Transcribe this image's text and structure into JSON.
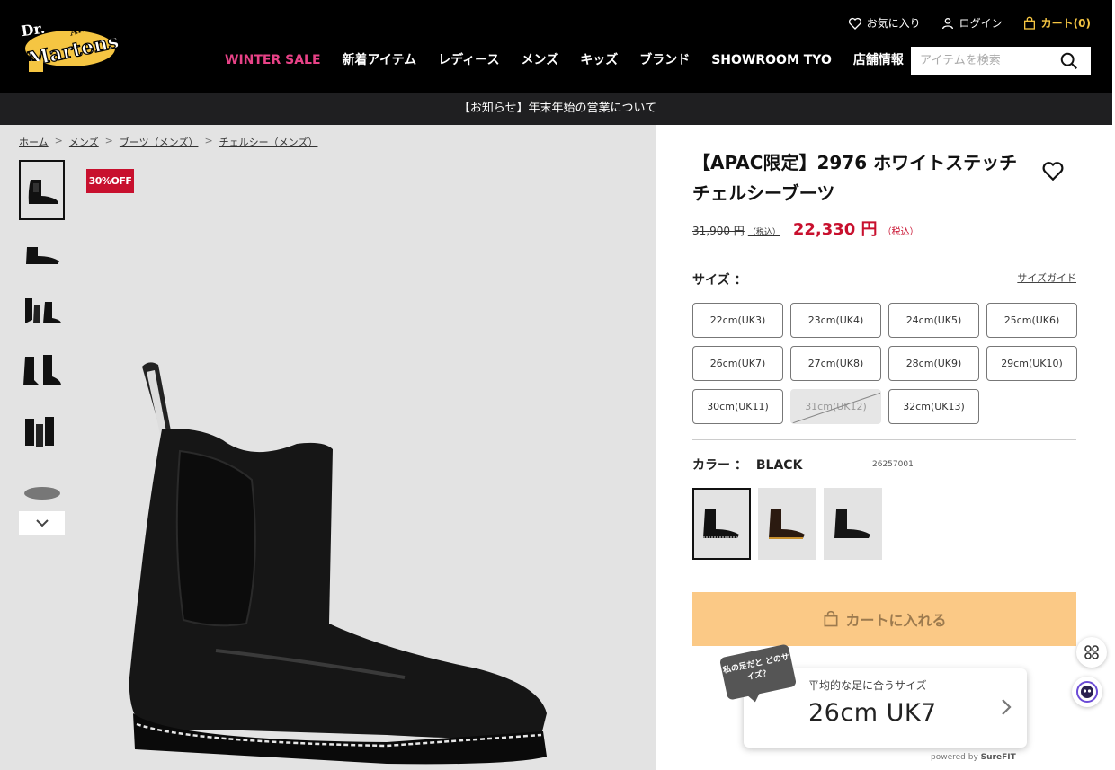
{
  "header": {
    "logo_text": "Dr. Martens AirWair",
    "utility": {
      "favorites": "お気に入り",
      "login": "ログイン",
      "cart": "カート(0)"
    },
    "nav": [
      "WINTER SALE",
      "新着アイテム",
      "レディース",
      "メンズ",
      "キッズ",
      "ブランド",
      "SHOWROOM TYO",
      "店舗情報"
    ],
    "search_placeholder": "アイテムを検索"
  },
  "notice": "【お知らせ】年末年始の営業について",
  "breadcrumb": [
    "ホーム",
    "メンズ",
    "ブーツ（メンズ）",
    "チェルシー（メンズ）"
  ],
  "badge": "30%OFF",
  "product": {
    "title": "【APAC限定】2976 ホワイトステッチ チェルシーブーツ",
    "old_price": "31,900 円",
    "old_price_tax": "（税込）",
    "new_price": "22,330 円",
    "new_price_tax": "（税込）",
    "size_label": "サイズ ：",
    "size_guide": "サイズガイド",
    "sizes": [
      {
        "label": "22cm(UK3)",
        "available": true
      },
      {
        "label": "23cm(UK4)",
        "available": true
      },
      {
        "label": "24cm(UK5)",
        "available": true
      },
      {
        "label": "25cm(UK6)",
        "available": true
      },
      {
        "label": "26cm(UK7)",
        "available": true
      },
      {
        "label": "27cm(UK8)",
        "available": true
      },
      {
        "label": "28cm(UK9)",
        "available": true
      },
      {
        "label": "29cm(UK10)",
        "available": true
      },
      {
        "label": "30cm(UK11)",
        "available": true
      },
      {
        "label": "31cm(UK12)",
        "available": false
      },
      {
        "label": "32cm(UK13)",
        "available": true
      }
    ],
    "color_label": "カラー ：",
    "color_value": "BLACK",
    "sku": "26257001",
    "cart_button": "カートに入れる"
  },
  "surefit": {
    "bubble": "私の足だと どのサイズ？",
    "caption": "平均的な足に合うサイズ",
    "value": "26cm UK7",
    "powered": "powered by",
    "brand": "SureFIT"
  },
  "colors": {
    "sale": "#e84287",
    "badge": "#c8102e",
    "price": "#c8102e",
    "cart_button": "#fbc986",
    "cart_header": "#f5c542"
  }
}
